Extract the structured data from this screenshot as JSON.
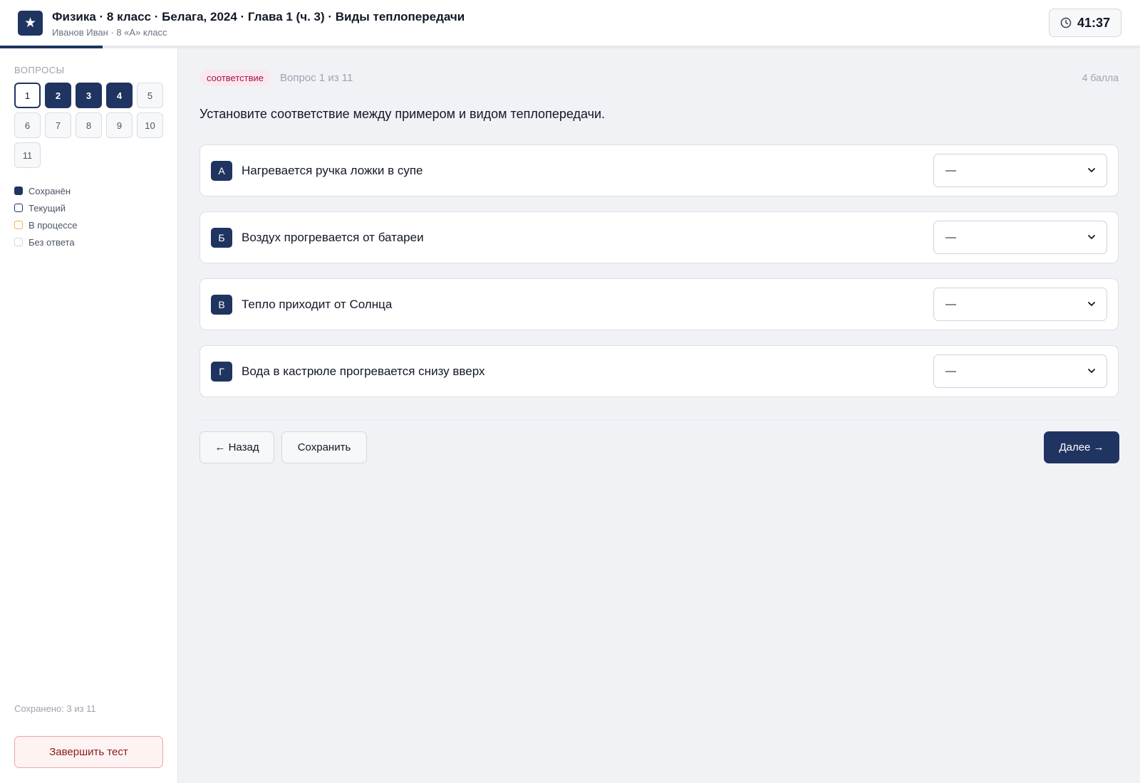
{
  "header": {
    "logo_glyph": "★",
    "title": "Физика · 8 класс · Белага, 2024 · Глава 1 (ч. 3) · Виды теплопередачи",
    "subtitle": "Иванов Иван · 8 «А» класс",
    "timer": "41:37",
    "progress_fraction": 0.09
  },
  "sidebar": {
    "heading": "ВОПРОСЫ",
    "questions": [
      {
        "label": "1",
        "state": "current"
      },
      {
        "label": "2",
        "state": "saved"
      },
      {
        "label": "3",
        "state": "saved"
      },
      {
        "label": "4",
        "state": "saved"
      },
      {
        "label": "5",
        "state": "empty"
      },
      {
        "label": "6",
        "state": "empty"
      },
      {
        "label": "7",
        "state": "empty"
      },
      {
        "label": "8",
        "state": "empty"
      },
      {
        "label": "9",
        "state": "empty"
      },
      {
        "label": "10",
        "state": "empty"
      },
      {
        "label": "11",
        "state": "empty"
      }
    ],
    "legend": [
      {
        "label": "Сохранён",
        "state": "saved"
      },
      {
        "label": "Текущий",
        "state": "current"
      },
      {
        "label": "В процессе",
        "state": "progress"
      },
      {
        "label": "Без ответа",
        "state": "empty"
      }
    ],
    "saved_count": "Сохранено: 3 из 11",
    "finish_label": "Завершить тест"
  },
  "main": {
    "tag": "соответствие",
    "question_number": "Вопрос 1 из 11",
    "points": "4 балла",
    "question_text": "Установите соответствие между примером и видом теплопередачи.",
    "rows": [
      {
        "letter": "А",
        "text": "Нагревается ручка ложки в супе",
        "selected": "—"
      },
      {
        "letter": "Б",
        "text": "Воздух прогревается от батареи",
        "selected": "—"
      },
      {
        "letter": "В",
        "text": "Тепло приходит от Солнца",
        "selected": "—"
      },
      {
        "letter": "Г",
        "text": "Вода в кастрюле прогревается снизу вверх",
        "selected": "—"
      }
    ],
    "back_label": "← Назад",
    "save_label": "Сохранить",
    "next_label": "Далее →"
  },
  "colors": {
    "accent": "#1f3460",
    "tag_bg": "#fbe7ee",
    "tag_text": "#a3164a",
    "finish_border": "#f2a1a1",
    "progress_legend": "#f0b73a"
  },
  "icons": {
    "logo": "star-icon",
    "timer": "clock-icon",
    "select": "chevron-down-icon"
  }
}
